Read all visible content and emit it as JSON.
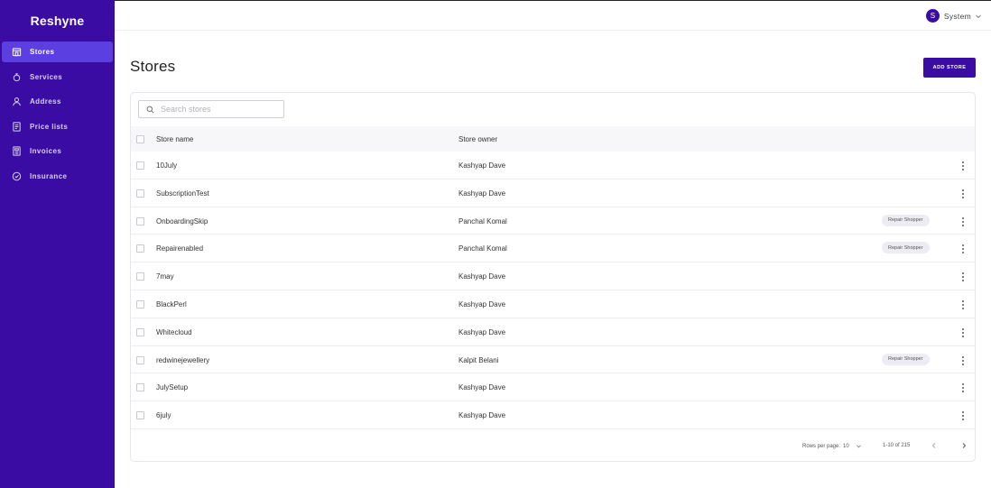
{
  "sidebar": {
    "brand": "Reshyne",
    "items": [
      {
        "label": "Stores",
        "icon": "store-icon",
        "active": true
      },
      {
        "label": "Services",
        "icon": "services-icon",
        "active": false
      },
      {
        "label": "Address",
        "icon": "address-icon",
        "active": false
      },
      {
        "label": "Price lists",
        "icon": "price-list-icon",
        "active": false
      },
      {
        "label": "Invoices",
        "icon": "invoice-icon",
        "active": false
      },
      {
        "label": "Insurance",
        "icon": "shield-icon",
        "active": false
      }
    ]
  },
  "topbar": {
    "user_initial": "S",
    "user_name": "System"
  },
  "main": {
    "title": "Stores",
    "add_button": "ADD STORE",
    "search_placeholder": "Search stores",
    "columns": {
      "name": "Store name",
      "owner": "Store owner"
    },
    "rows": [
      {
        "name": "10July",
        "owner": "Kashyap Dave",
        "badge": ""
      },
      {
        "name": "SubscriptionTest",
        "owner": "Kashyap Dave",
        "badge": ""
      },
      {
        "name": "OnboardingSkip",
        "owner": "Panchal Komal",
        "badge": "Repair Shopper"
      },
      {
        "name": "Repairenabled",
        "owner": "Panchal Komal",
        "badge": "Repair Shopper"
      },
      {
        "name": "7may",
        "owner": "Kashyap Dave",
        "badge": ""
      },
      {
        "name": "BlackPerl",
        "owner": "Kashyap Dave",
        "badge": ""
      },
      {
        "name": "Whitecloud",
        "owner": "Kashyap Dave",
        "badge": ""
      },
      {
        "name": "redwinejewellery",
        "owner": "Kalpit Belani",
        "badge": "Repair Shopper"
      },
      {
        "name": "JulySetup",
        "owner": "Kashyap Dave",
        "badge": ""
      },
      {
        "name": "6july",
        "owner": "Kashyap Dave",
        "badge": ""
      }
    ],
    "pagination": {
      "rows_per_page_label": "Rows per page:",
      "rows_per_page_value": "10",
      "range": "1-10 of 215"
    }
  },
  "colors": {
    "sidebar_bg": "#3a0ca3",
    "sidebar_active": "#5b3fe0",
    "accent": "#3a0ca3"
  }
}
